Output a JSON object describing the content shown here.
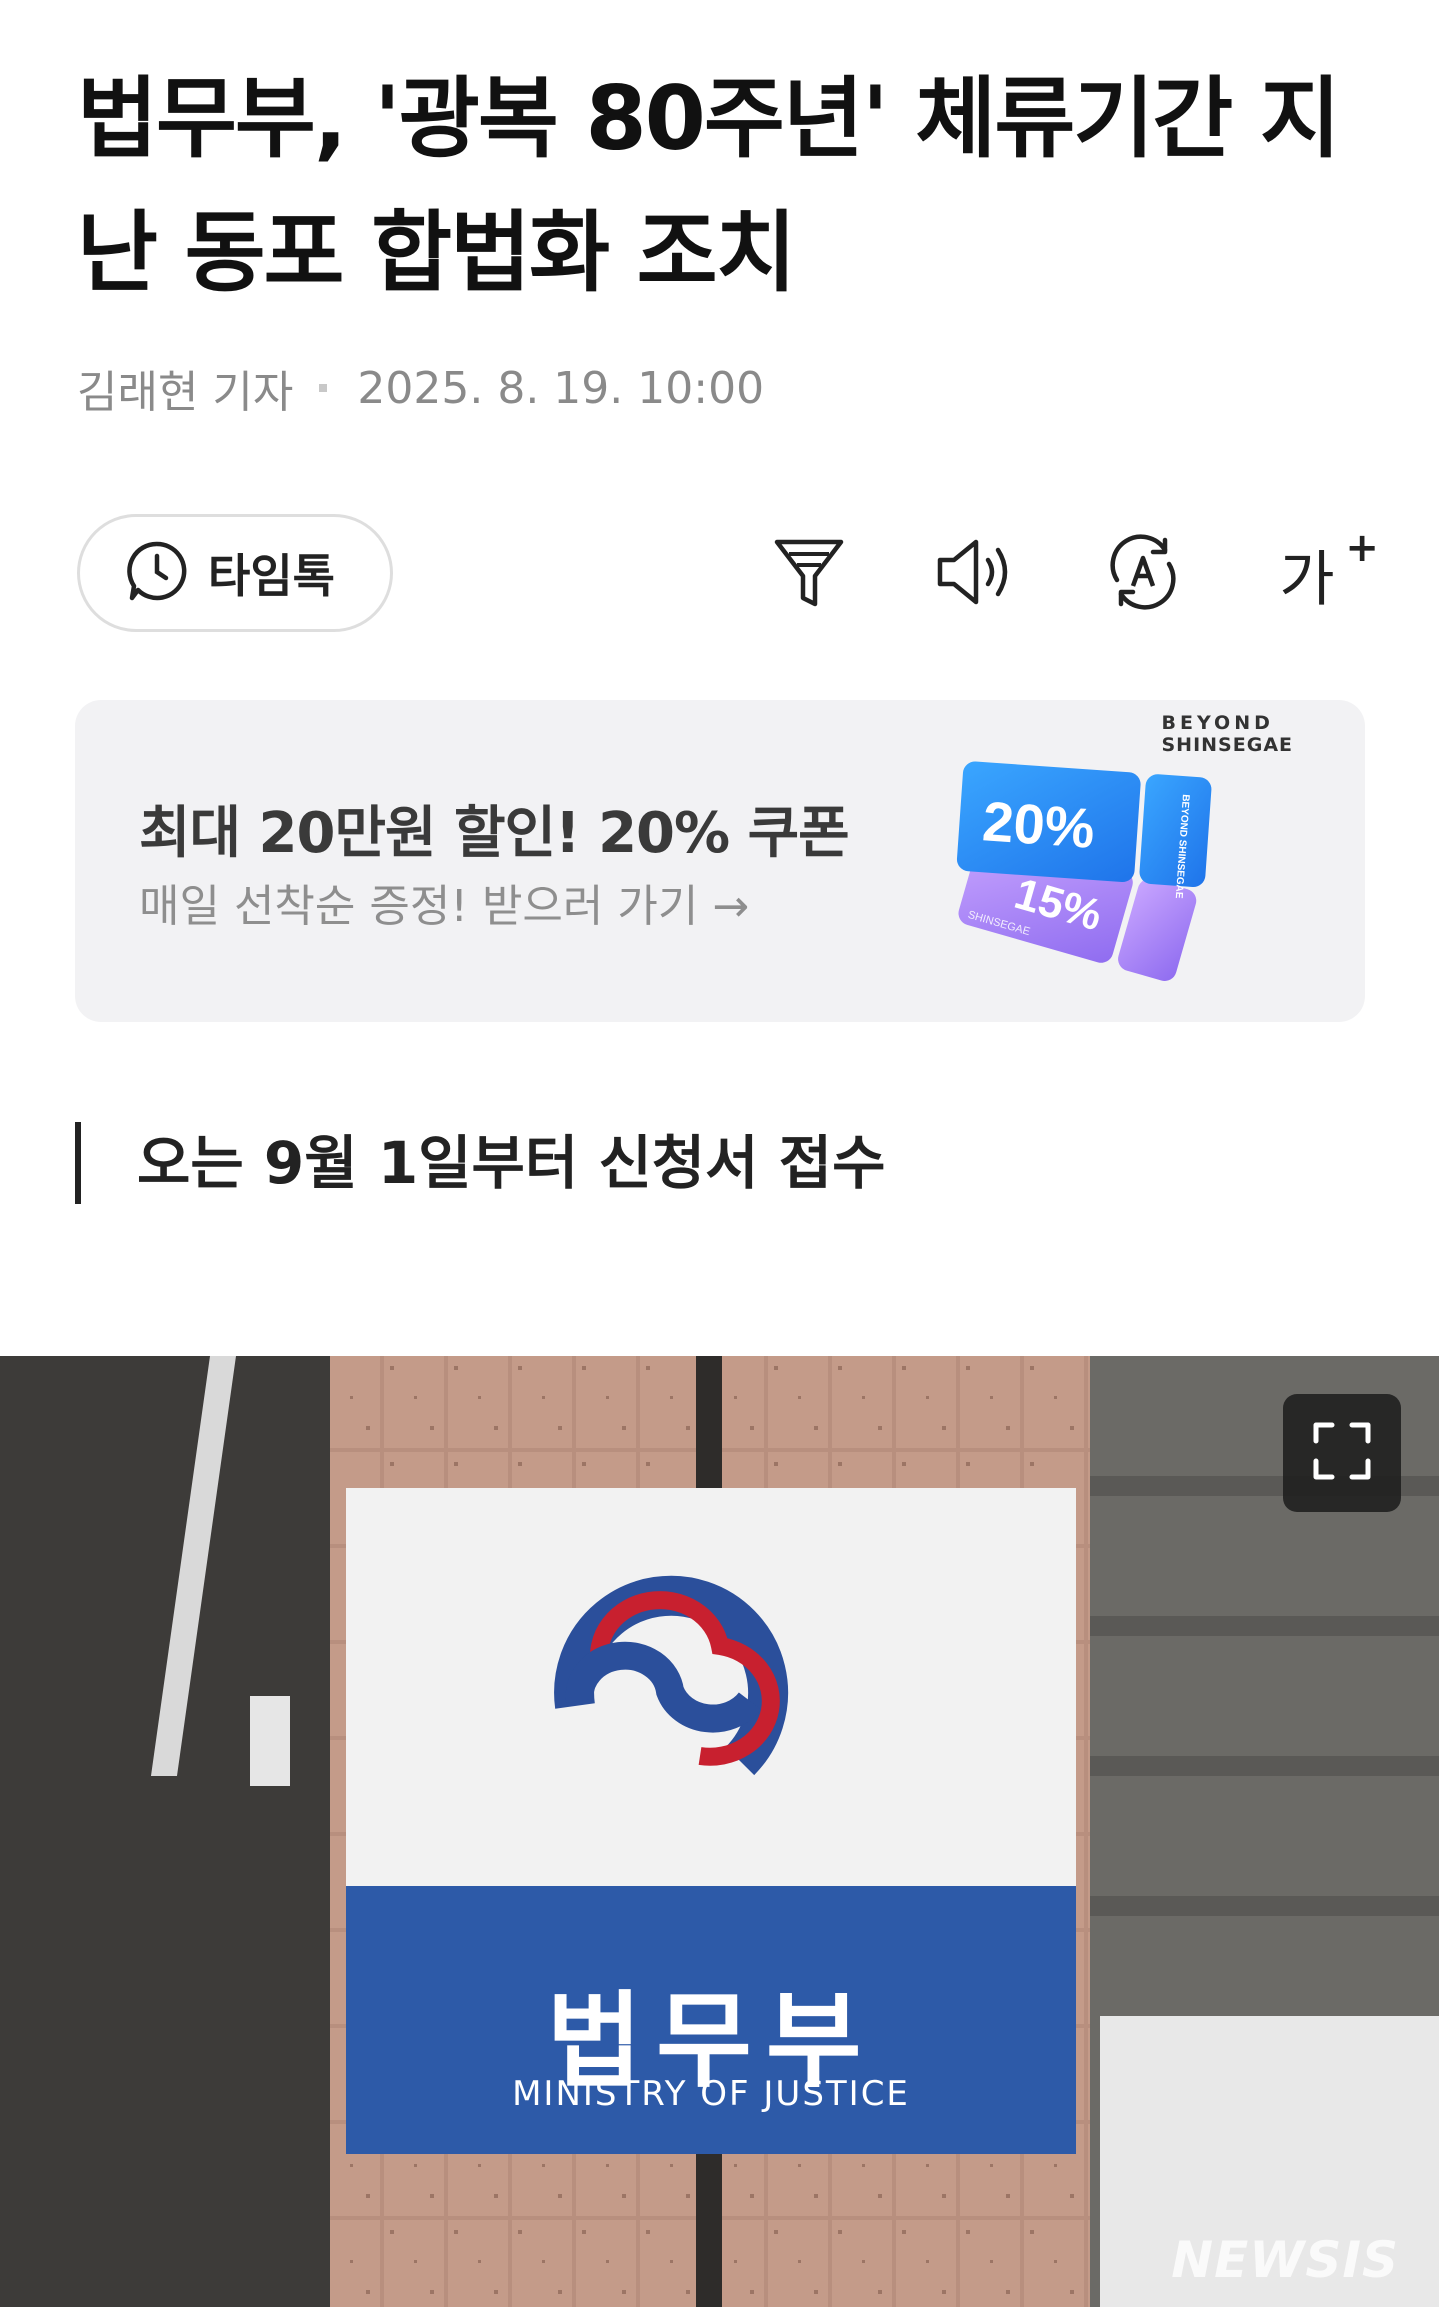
{
  "article": {
    "title_line1": "법무부, '광복 80주년' 체류기간 지",
    "title_line2": "난 동포 합법화 조치",
    "author": "김래현 기자",
    "datetime": "2025. 8. 19. 10:00",
    "subheading": "오는 9월 1일부터 신청서 접수"
  },
  "toolbar": {
    "timetalk_label": "타임톡",
    "fontsize_label": "가",
    "fontsize_plus": "+",
    "icons": [
      "clock-chat-icon",
      "summary-filter-icon",
      "speaker-icon",
      "translate-icon",
      "font-size-icon"
    ]
  },
  "ad": {
    "title": "최대 20만원 할인! 20% 쿠폰",
    "subtitle": "매일 선착순 증정! 받으러 가기 →",
    "brand_line1": "BEYOND",
    "brand_line2": "SHINSEGAE",
    "coupon1": "20%",
    "coupon2": "15%",
    "coupon_brand": "BEYOND SHINSEGAE",
    "coupon2_brand": "SHINSEGAE",
    "coupon1_color": "#2a8cf5",
    "coupon2_color": "#a57cf2"
  },
  "photo": {
    "sign_korean": "법무부",
    "sign_english": "MINISTRY OF JUSTICE",
    "watermark": "NEWSIS",
    "sign_blue": "#2d5aa8",
    "emblem_red": "#c8202f",
    "emblem_blue": "#2b4f9b"
  }
}
